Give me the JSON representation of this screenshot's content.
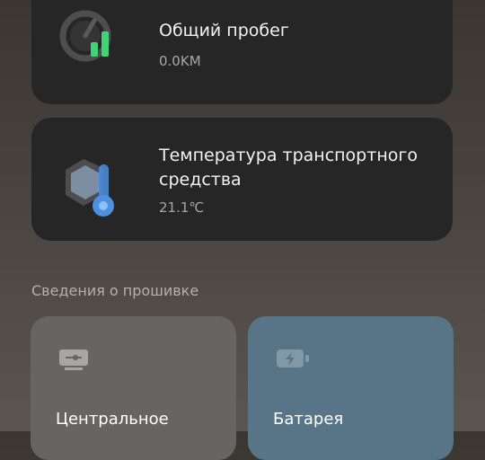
{
  "cards": [
    {
      "id": "mileage",
      "title": "Общий пробег",
      "value": "0.0KM",
      "icon": "speedometer-icon"
    },
    {
      "id": "temperature",
      "title": "Температура транспортного средства",
      "value": "21.1℃",
      "icon": "thermometer-icon"
    }
  ],
  "firmware": {
    "section_title": "Сведения о прошивке",
    "tiles": [
      {
        "label": "Центральное",
        "icon": "controller-icon"
      },
      {
        "label": "Батарея",
        "icon": "battery-icon"
      }
    ]
  },
  "colors": {
    "card_bg": "#262626",
    "accent_green": "#3fd475",
    "accent_blue": "#4d8fe0",
    "tile_central": "#676563",
    "tile_battery": "#587588"
  }
}
